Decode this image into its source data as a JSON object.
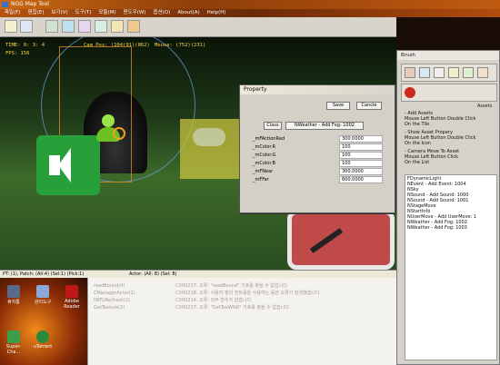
{
  "window": {
    "title": "NGG Map Tool"
  },
  "menu": [
    "파일(F)",
    "편집(E)",
    "보기(V)",
    "도구(T)",
    "모듈(M)",
    "윈도우(W)",
    "옵션(O)",
    "About(A)",
    "Help(H)"
  ],
  "hud": {
    "time": "TIME: 0: 3: 4",
    "fps": "FPS: 156",
    "cam_pos": "Cam Pos: (104(91)(862)",
    "mouse": "Mouse: (752)(231)"
  },
  "property": {
    "title": "Property",
    "save": "Save",
    "cancel": "Cancle",
    "class_label": "Class",
    "class_value": "NWeather - Add Fog: 1002",
    "rows": [
      {
        "key": "_mFActionRad",
        "value": "300.0000"
      },
      {
        "key": "_mColor.R",
        "value": "100"
      },
      {
        "key": "_mColor.G",
        "value": "100"
      },
      {
        "key": "_mColor.B",
        "value": "100"
      },
      {
        "key": "_mFNear",
        "value": "300.0000"
      },
      {
        "key": "_mFFar",
        "value": "600.0000"
      }
    ]
  },
  "brush": {
    "title": "Brush",
    "assets_label": "Assets",
    "help": [
      [
        "- Add Assets",
        "Mouse Left Button Double Click",
        "On the Tile"
      ],
      [
        "- Show Asset Propery",
        "Mouse Left Button Double Click",
        "On the Icon"
      ],
      [
        "- Camera Move To Asset",
        "Mouse Left Button Click",
        "On the List"
      ]
    ],
    "list": [
      "FDynamicLight",
      "NEvent - Add Event: 1004",
      "NSky",
      "NSound - Add Sound: 1000",
      "NSound - Add Sound: 1001",
      "NStageMove",
      "NStartInfo",
      "NUserMove - Add UserMove: 1",
      "NWeather - Add Fog: 1002",
      "NWeather - Add Fog: 1003"
    ]
  },
  "status": {
    "left": "PT: (1), Patch: (All:4) (Sel:1) (Pick:1)",
    "right": "Actor: (All: 8) (Sel: 8)"
  },
  "desktop": [
    {
      "label": "휴지통"
    },
    {
      "label": "관리도구"
    },
    {
      "label": "Adobe Reader"
    },
    {
      "label": "Super-Cha..."
    },
    {
      "label": "uTorrent"
    }
  ],
  "log": [
    {
      "source": "readBound(4)",
      "message": "CX00217: 오류: \"readBound\" 기호를 찾을 수 없습니다."
    },
    {
      "source": "CManagerActor(1)",
      "message": "CX00218: 오류: 사용자 정의 컨트롤을 사용하는 동안 오류가 발생했습니다."
    },
    {
      "source": "IWFLRecheck(2)",
      "message": "CX00214: 오류: 외부 변수가 없습니다."
    },
    {
      "source": "GetTexture(2)",
      "message": "CX00217: 오류: \"GetTexWNR\" 기호를 찾을 수 없습니다."
    }
  ],
  "colors": {
    "hud_text": "#ffd54a",
    "title_orange": "#c96a12"
  }
}
